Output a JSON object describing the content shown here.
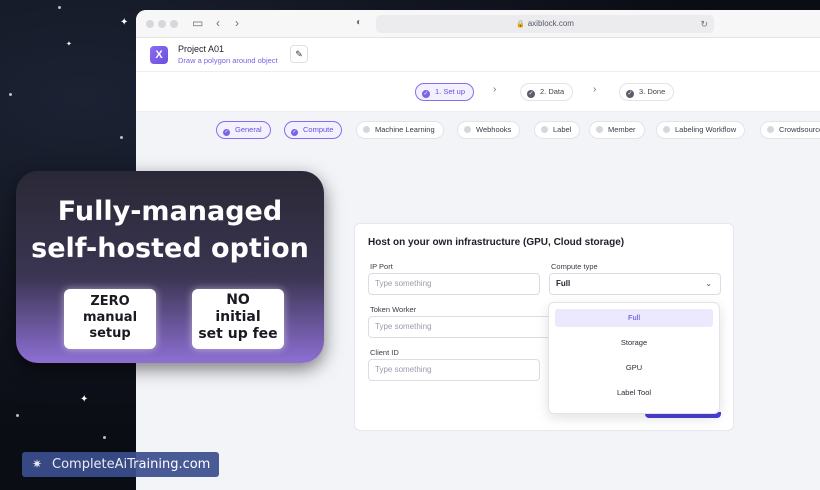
{
  "browser": {
    "url": "axiblock.com"
  },
  "app": {
    "project_title": "Project A01",
    "project_subtitle": "Draw a polygon around object"
  },
  "steps": [
    {
      "label": "1. Set up",
      "active": true
    },
    {
      "label": "2. Data",
      "active": false
    },
    {
      "label": "3. Done",
      "active": false
    }
  ],
  "tabs": [
    {
      "label": "General",
      "active": true
    },
    {
      "label": "Compute",
      "active": true
    },
    {
      "label": "Machine Learning",
      "active": false
    },
    {
      "label": "Webhooks",
      "active": false
    },
    {
      "label": "Label",
      "active": false
    },
    {
      "label": "Member",
      "active": false
    },
    {
      "label": "Labeling Workflow",
      "active": false
    },
    {
      "label": "Crowdsource",
      "active": false
    }
  ],
  "form": {
    "title": "Host on your own infrastructure (GPU, Cloud storage)",
    "ip_port_label": "IP Port",
    "ip_port_placeholder": "Type something",
    "compute_type_label": "Compute type",
    "compute_type_value": "Full",
    "token_worker_label": "Token Worker",
    "token_worker_placeholder": "Type something",
    "client_id_label": "Client ID",
    "client_id_placeholder": "Type something"
  },
  "dropdown": {
    "options": [
      "Full",
      "Storage",
      "GPU",
      "Label Tool"
    ],
    "selected": "Full"
  },
  "promo": {
    "headline_line1": "Fully-managed",
    "headline_line2": "self-hosted option",
    "badge1_line1": "ZERO",
    "badge1_line2": "manual",
    "badge1_line3": "setup",
    "badge2_line1": "NO",
    "badge2_line2": "initial",
    "badge2_line3": "set up fee"
  },
  "watermark": {
    "text": "CompleteAiTraining.com"
  },
  "colors": {
    "accent": "#7b62e6",
    "primary_button": "#4c3fd8",
    "promo_gradient_end": "#8d6fd3"
  }
}
